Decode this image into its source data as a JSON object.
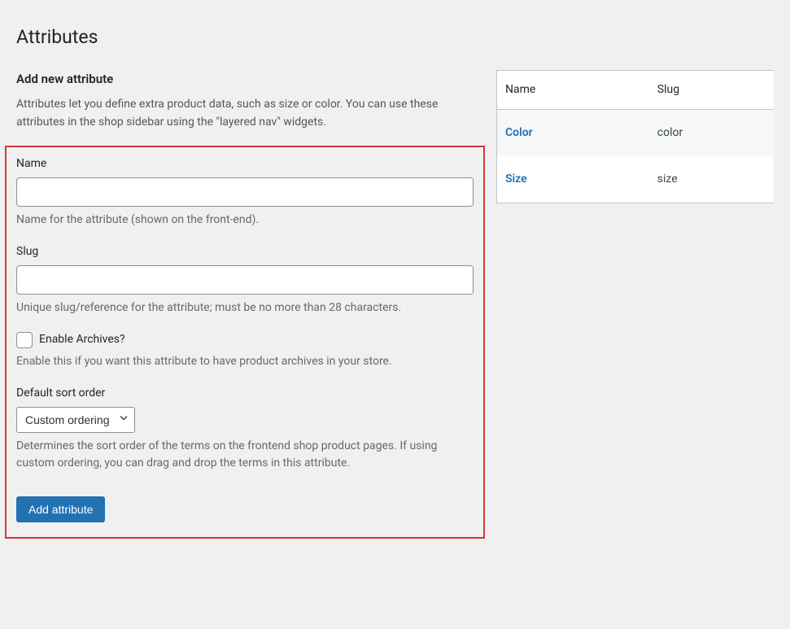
{
  "page": {
    "title": "Attributes"
  },
  "form": {
    "heading": "Add new attribute",
    "intro": "Attributes let you define extra product data, such as size or color. You can use these attributes in the shop sidebar using the \"layered nav\" widgets.",
    "name": {
      "label": "Name",
      "value": "",
      "description": "Name for the attribute (shown on the front-end)."
    },
    "slug": {
      "label": "Slug",
      "value": "",
      "description": "Unique slug/reference for the attribute; must be no more than 28 characters."
    },
    "archives": {
      "label": "Enable Archives?",
      "checked": false,
      "description": "Enable this if you want this attribute to have product archives in your store."
    },
    "sort": {
      "label": "Default sort order",
      "selected": "Custom ordering",
      "description": "Determines the sort order of the terms on the frontend shop product pages. If using custom ordering, you can drag and drop the terms in this attribute."
    },
    "submit_label": "Add attribute"
  },
  "table": {
    "headers": {
      "name": "Name",
      "slug": "Slug"
    },
    "rows": [
      {
        "name": "Color",
        "slug": "color"
      },
      {
        "name": "Size",
        "slug": "size"
      }
    ]
  }
}
